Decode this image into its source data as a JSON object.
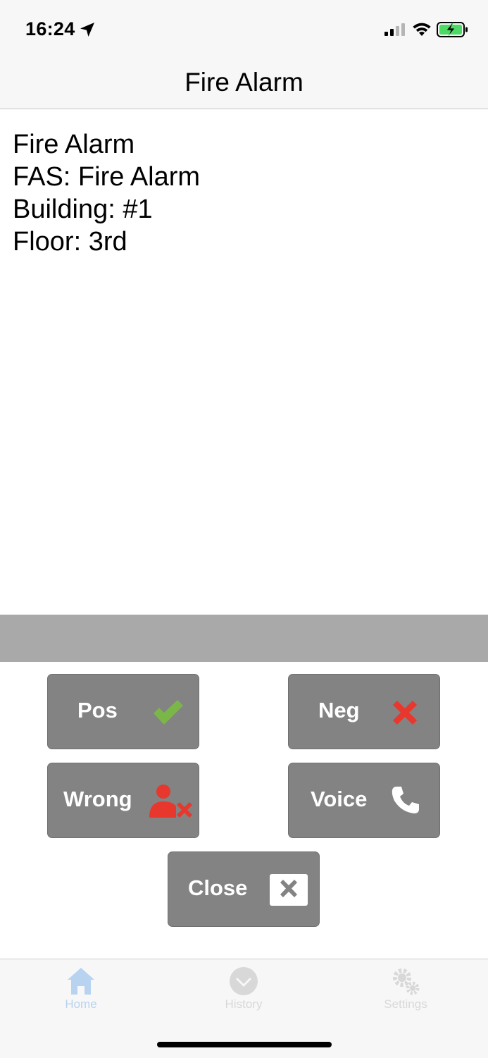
{
  "status_bar": {
    "time": "16:24",
    "icons": [
      "location-arrow-icon",
      "cellular-signal-icon",
      "wifi-icon",
      "battery-charging-icon"
    ]
  },
  "nav": {
    "title": "Fire Alarm"
  },
  "alarm": {
    "lines": [
      "Fire Alarm",
      "FAS: Fire Alarm",
      "Building: #1",
      "Floor: 3rd"
    ]
  },
  "actions": {
    "pos": {
      "label": "Pos",
      "icon": "checkmark-icon",
      "color": "#7ab648"
    },
    "neg": {
      "label": "Neg",
      "icon": "red-x-icon",
      "color": "#e8372c"
    },
    "wrong": {
      "label": "Wrong",
      "icon": "user-x-icon",
      "color": "#e8372c"
    },
    "voice": {
      "label": "Voice",
      "icon": "phone-icon",
      "color": "#ffffff"
    },
    "close": {
      "label": "Close",
      "icon": "close-box-icon",
      "color": "#ffffff"
    }
  },
  "tabs": [
    {
      "label": "Home",
      "icon": "home-icon",
      "active": true
    },
    {
      "label": "History",
      "icon": "clock-icon",
      "active": false
    },
    {
      "label": "Settings",
      "icon": "gear-icon",
      "active": false
    }
  ],
  "colors": {
    "button_bg": "#838383",
    "gray_bar": "#a9a9a9",
    "tab_active": "#b8d3f0",
    "tab_inactive": "#d8d8d8",
    "battery_green": "#4cd964"
  }
}
